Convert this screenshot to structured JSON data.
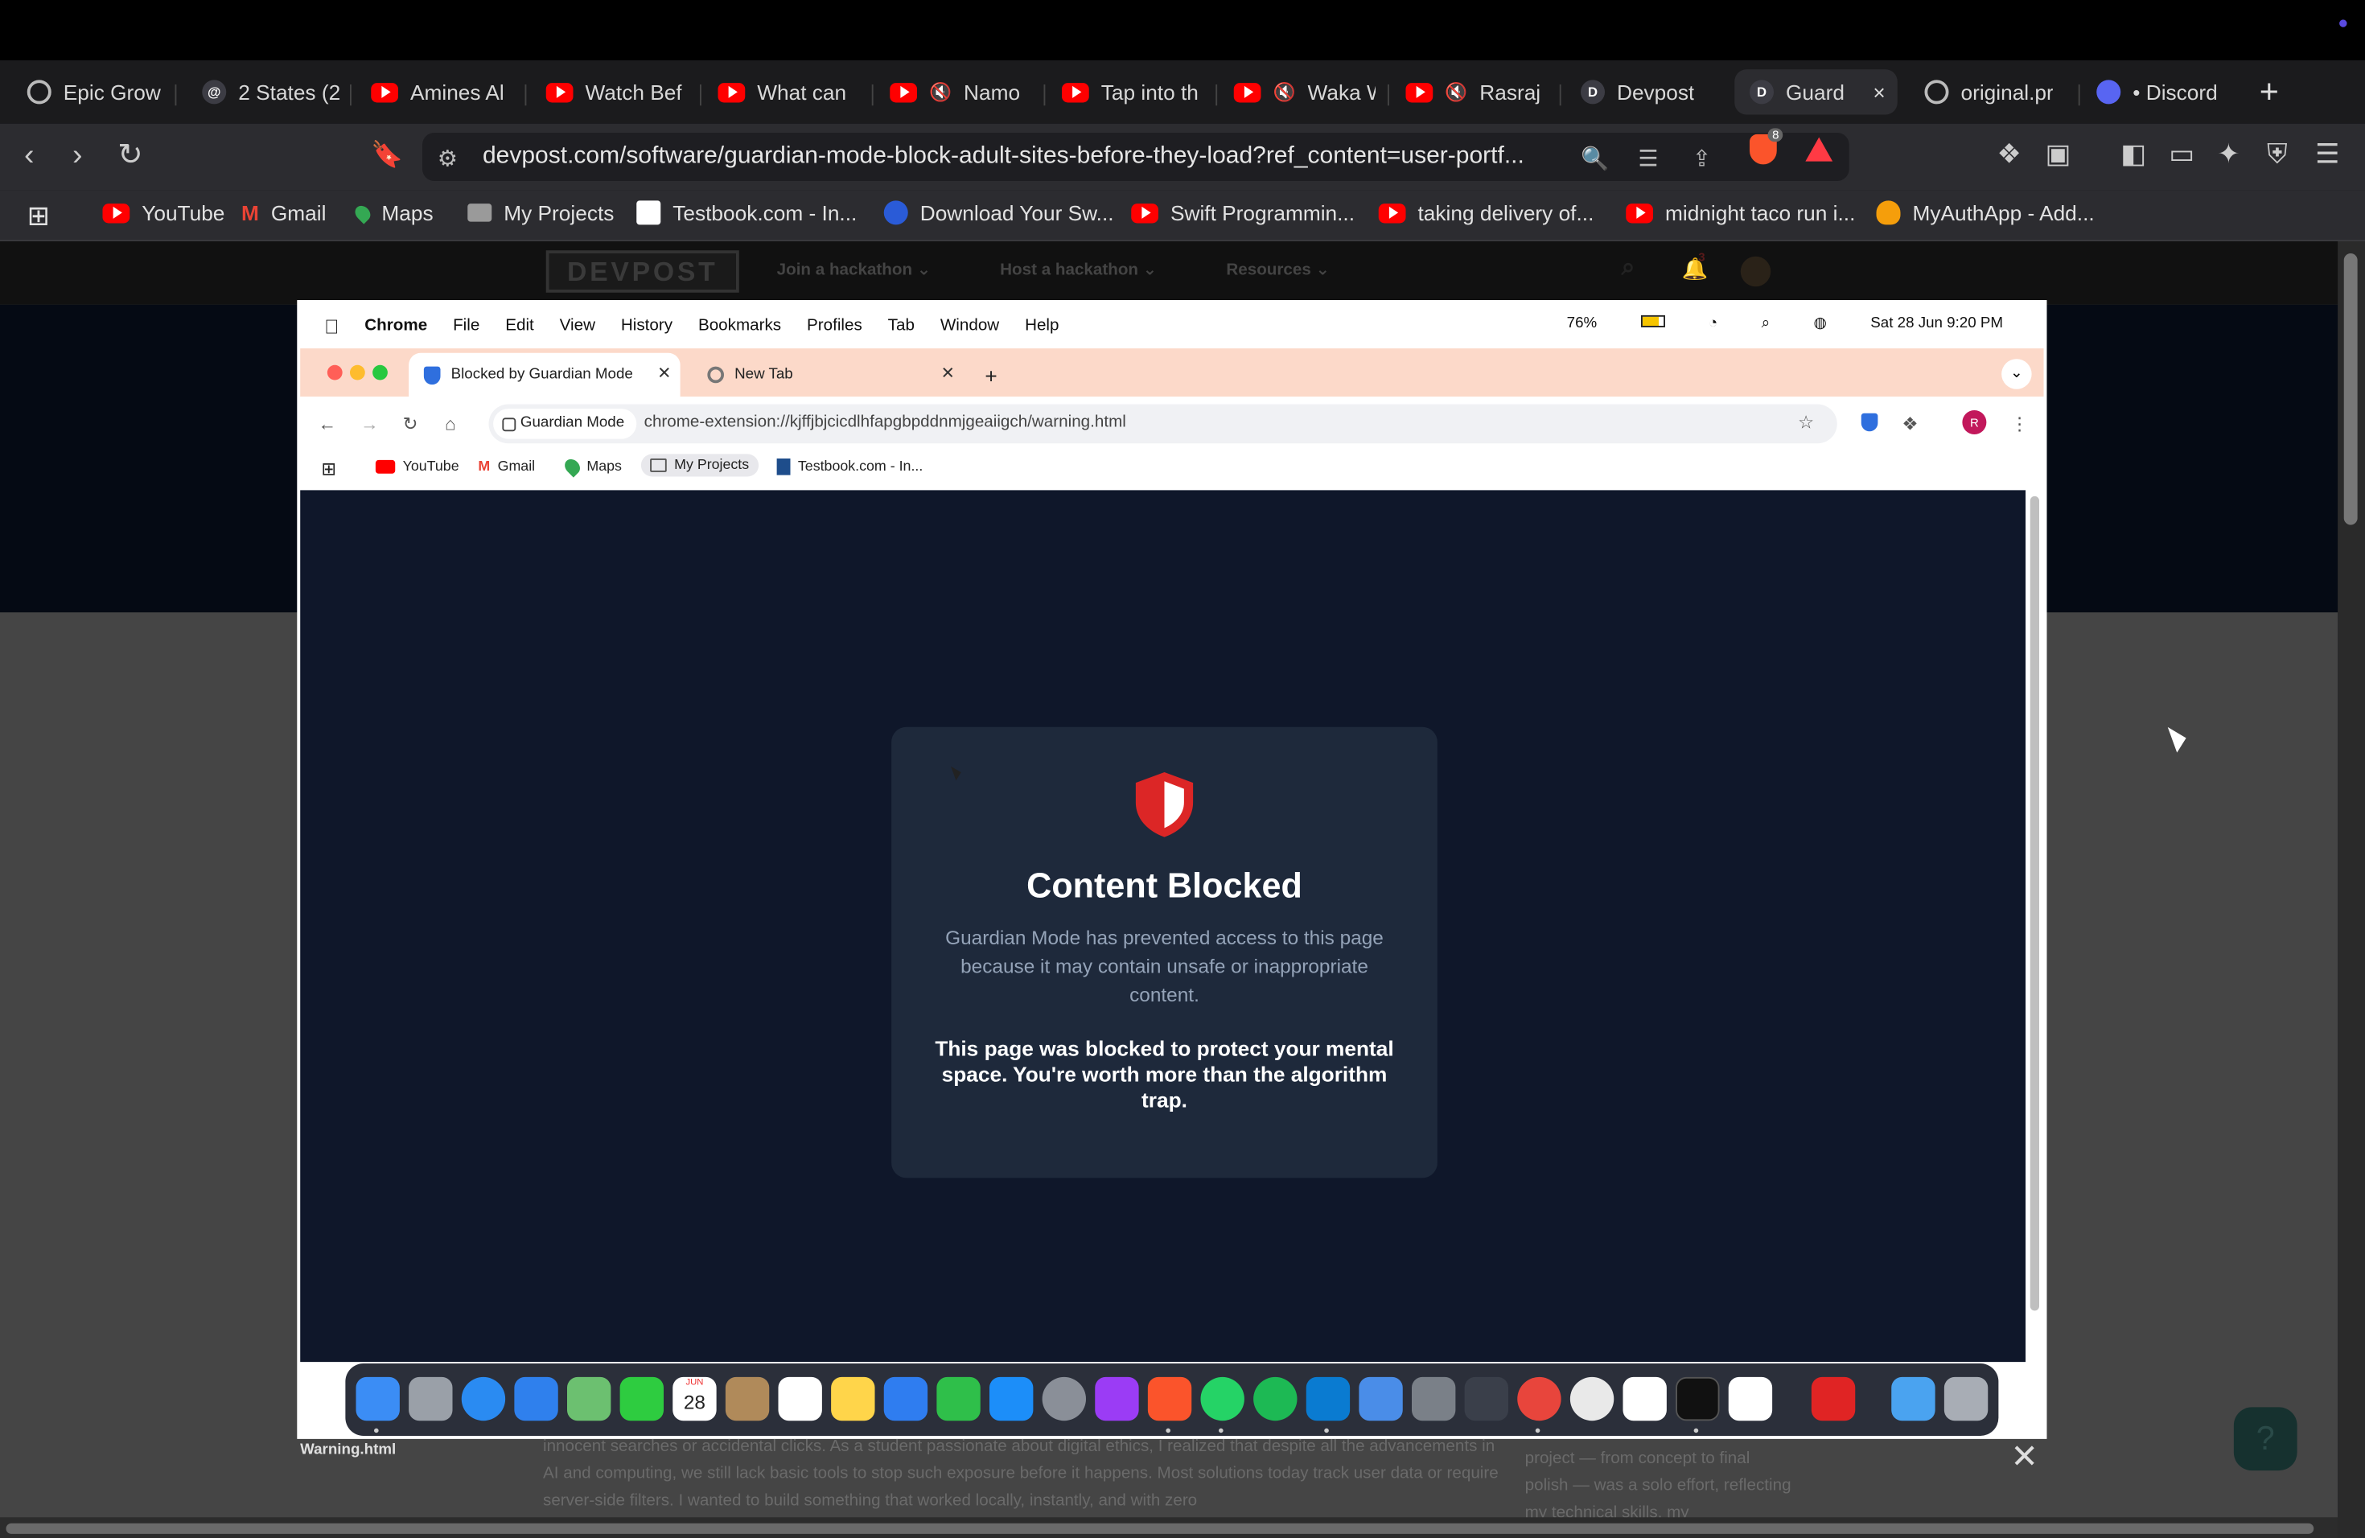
{
  "browser": {
    "tabs": [
      {
        "label": "Epic Grow",
        "icon": "openai-icon"
      },
      {
        "label": "2 States (2",
        "icon": "threads-icon"
      },
      {
        "label": "Amines Al",
        "icon": "youtube-icon"
      },
      {
        "label": "Watch Bef",
        "icon": "youtube-icon"
      },
      {
        "label": "What can",
        "icon": "youtube-icon"
      },
      {
        "label": "Namo",
        "icon": "youtube-icon"
      },
      {
        "label": "Tap into th",
        "icon": "youtube-icon"
      },
      {
        "label": "Waka W",
        "icon": "youtube-icon"
      },
      {
        "label": "Rasraj",
        "icon": "youtube-icon"
      },
      {
        "label": "Devpost",
        "icon": "devpost-icon"
      },
      {
        "label": "Guard",
        "icon": "devpost-icon"
      },
      {
        "label": "original.pr",
        "icon": "globe-icon"
      },
      {
        "label": "• Discord",
        "icon": "discord-icon"
      }
    ],
    "devpost_favicon": "D",
    "new_tab_symbol": "+",
    "close_symbol": "×",
    "brave_shield_count": "8",
    "url": "devpost.com/software/guardian-mode-block-adult-sites-before-they-load?ref_content=user-portf...",
    "bookmarks": [
      {
        "label": "YouTube",
        "icon": "youtube-icon"
      },
      {
        "label": "Gmail",
        "icon": "gmail-icon"
      },
      {
        "label": "Maps",
        "icon": "maps-icon"
      },
      {
        "label": "My Projects",
        "icon": "folder-icon"
      },
      {
        "label": "Testbook.com - In...",
        "icon": "testbook-icon"
      },
      {
        "label": "Download Your Sw...",
        "icon": "swift-icon"
      },
      {
        "label": "Swift Programmin...",
        "icon": "youtube-icon"
      },
      {
        "label": "taking delivery of...",
        "icon": "youtube-icon"
      },
      {
        "label": "midnight taco run i...",
        "icon": "youtube-icon"
      },
      {
        "label": "MyAuthApp - Add...",
        "icon": "firebase-icon"
      }
    ]
  },
  "devpost": {
    "logo": "DEVPOST",
    "nav": [
      "Join a hackathon ⌄",
      "Host a hackathon ⌄",
      "Resources ⌄"
    ],
    "notification_count": "3",
    "body_text": "innocent searches or accidental clicks. As a student passionate about digital ethics, I realized that despite all the advancements in AI and computing, we still lack basic tools to stop such exposure before it happens. Most solutions today track user data or require server-side filters. I wanted to build something that worked locally, instantly, and with zero",
    "side_text": "project — from concept to final polish — was a solo effort, reflecting my technical skills, my",
    "help_label": "?",
    "filename": "Warning.html"
  },
  "embedded": {
    "menubar": [
      "Chrome",
      "File",
      "Edit",
      "View",
      "History",
      "Bookmarks",
      "Profiles",
      "Tab",
      "Window",
      "Help"
    ],
    "battery": "76%",
    "datetime": "Sat 28 Jun  9:20 PM",
    "tabs": [
      {
        "label": "Blocked by Guardian Mode"
      },
      {
        "label": "New Tab"
      }
    ],
    "chip": "Guardian Mode",
    "url": "chrome-extension://kjffjbjcicdlhfapgbpddnmjgeaiigch/warning.html",
    "avatar_letter": "R",
    "bookmarks": [
      "YouTube",
      "Gmail",
      "Maps",
      "My Projects",
      "Testbook.com - In..."
    ],
    "card": {
      "title": "Content Blocked",
      "description": "Guardian Mode has prevented access to this page because it may contain unsafe or inappropriate content.",
      "message": "This page was blocked to protect your mental space. You're worth more than the algorithm trap."
    },
    "calendar_month": "JUN",
    "calendar_day": "28"
  },
  "colors": {
    "card_bg": "#1e293b",
    "page_bg": "#0f172a",
    "shield_red": "#dc2626",
    "chrome_tab_tint": "#fcd9c9"
  }
}
